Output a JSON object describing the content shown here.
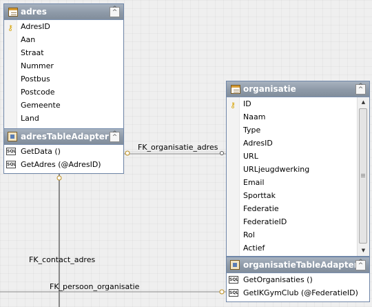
{
  "tables": {
    "adres": {
      "title": "adres",
      "columns": [
        "AdresID",
        "Aan",
        "Straat",
        "Nummer",
        "Postbus",
        "Postcode",
        "Gemeente",
        "Land"
      ]
    },
    "adresTableAdapter": {
      "title": "adresTableAdapter",
      "methods": [
        "GetData ()",
        "GetAdres (@AdresID)"
      ]
    },
    "organisatie": {
      "title": "organisatie",
      "columns": [
        "ID",
        "Naam",
        "Type",
        "AdresID",
        "URL",
        "URLjeugdwerking",
        "Email",
        "Sporttak",
        "Federatie",
        "FederatieID",
        "Rol",
        "Actief"
      ]
    },
    "organisatieTableAdapter": {
      "title": "organisatieTableAdapter",
      "methods": [
        "GetOrganisaties ()",
        "GetIKGymClub (@FederatieID)"
      ]
    }
  },
  "relations": {
    "fk_organisatie_adres": "FK_organisatie_adres",
    "fk_contact_adres": "FK_contact_adres",
    "fk_persoon_organisatie": "FK_persoon_organisatie"
  },
  "icons": {
    "collapse": "chevron-up-double-icon",
    "key": "primary-key-icon",
    "table": "table-icon",
    "adapter": "table-adapter-icon",
    "method": "sql-method-icon"
  },
  "colors": {
    "titlebar": "#8e9aa8",
    "border": "#6f86a8",
    "key": "#d7a200"
  }
}
